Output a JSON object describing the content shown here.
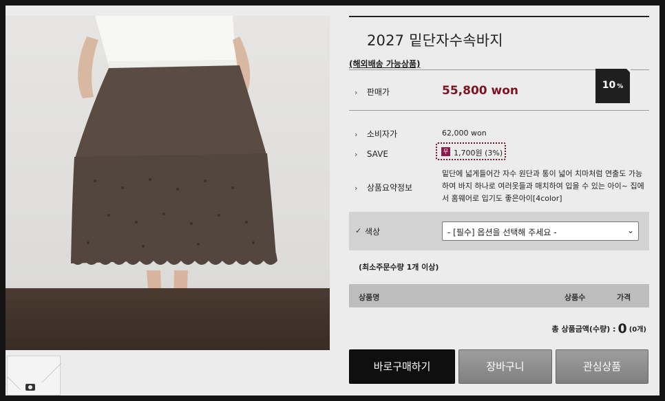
{
  "product": {
    "title": "2027 밑단자수속바지",
    "overseas_note": "(해외배송 가능상품)"
  },
  "pricing": {
    "sale_label": "판매가",
    "sale_price": "55,800 won",
    "discount_value": "10",
    "discount_unit": "%",
    "consumer_label": "소비자가",
    "consumer_price": "62,000 won",
    "save_label": "SAVE",
    "save_icon_text": "무",
    "save_value": "1,700원 (3%)"
  },
  "summary": {
    "label": "상품요약정보",
    "text": "밑단에 넓게들어간 자수 원단과 통이 넓어 치마처럼 연출도 가능하여 바지 하나로 여러옷들과 매치하여 입을 수 있는 아이~ 집에서 홈웨어로 입기도 좋은아이[4color]"
  },
  "option": {
    "label": "색상",
    "selected": "- [필수] 옵션을 선택해 주세요 -"
  },
  "min_order": "(최소주문수량 1개 이상)",
  "table": {
    "col_name": "상품명",
    "col_qty": "상품수",
    "col_price": "가격"
  },
  "total": {
    "label": "총 상품금액(수량) :",
    "amount": "0",
    "count": "(0개)"
  },
  "buttons": {
    "buy": "바로구매하기",
    "cart": "장바구니",
    "wish": "관심상품"
  },
  "colors": {
    "price_red": "#7a1420",
    "save_icon": "#8a1a4b",
    "buy_button": "#0f0f0f",
    "secondary_button": "#8a8a8a"
  }
}
